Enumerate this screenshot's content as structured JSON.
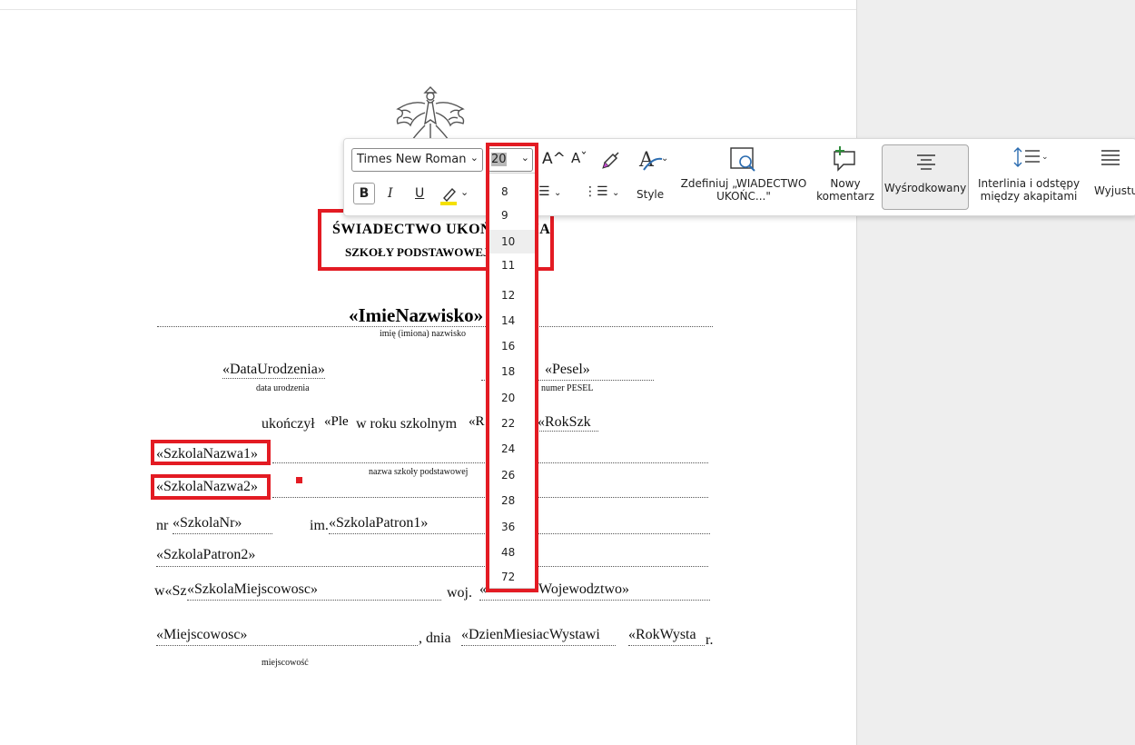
{
  "document": {
    "title_line1": "ŚWIADECTWO UKOŃCZENIA",
    "title_line2": "SZKOŁY PODSTAWOWEJ",
    "name_field": "«ImieNazwisko»",
    "name_caption": "imię (imiona) nazwisko",
    "birthdate_field": "«DataUrodzenia»",
    "birthdate_caption": "data urodzenia",
    "pesel_field": "«Pesel»",
    "pesel_caption": "numer PESEL",
    "completed_text": "ukończył",
    "ple_field": "«Ple",
    "school_year_text": "w roku szkolnym",
    "rok_field_1": "«R",
    "rok_field_2": "«RokSzk",
    "school_name1_field": "«SzkolaNazwa1»",
    "school_name_caption": "nazwa szkoły podstawowej",
    "school_name2_field": "«SzkolaNazwa2»",
    "nr_label": "nr",
    "school_nr_field": "«SzkolaNr»",
    "im_label": "im.",
    "patron1_field": "«SzkolaPatron1»",
    "patron2_field": "«SzkolaPatron2»",
    "w_label": "w«Sz",
    "school_city_field": "«SzkolaMiejscowosc»",
    "woj_label": "woj.",
    "woj_field_start": "«",
    "woj_field_end": "Wojewodztwo»",
    "place_field": "«Miejscowosc»",
    "place_caption": "miejscowość",
    "dnia_label": ", dnia",
    "issue_date_field": "«DzienMiesiacWystawi",
    "issue_year_field": "«RokWysta",
    "r_label": "r."
  },
  "toolbar": {
    "font_name": "Times New Roman",
    "font_size": "20",
    "style_label": "Style",
    "define_label_1": "Zdefiniuj „WIADECTWO",
    "define_label_2": "UKOŃC...\"",
    "new_comment_1": "Nowy",
    "new_comment_2": "komentarz",
    "center_label": "Wyśrodkowany",
    "spacing_label_1": "Interlinia i odstępy",
    "spacing_label_2": "między akapitami",
    "justify_label": "Wyjustuj",
    "bold": "B",
    "italic": "I",
    "underline": "U",
    "grow_font": "A^",
    "shrink_font": "Aˇ"
  },
  "font_size_options": [
    "8",
    "9",
    "10",
    "11",
    "12",
    "14",
    "16",
    "18",
    "20",
    "22",
    "24",
    "26",
    "28",
    "36",
    "48",
    "72"
  ],
  "colors": {
    "highlight_box": "#e31b23",
    "comment_icon": "#2e8b3a",
    "highlighter": "#f5e000",
    "pane": "#eeeeee"
  }
}
